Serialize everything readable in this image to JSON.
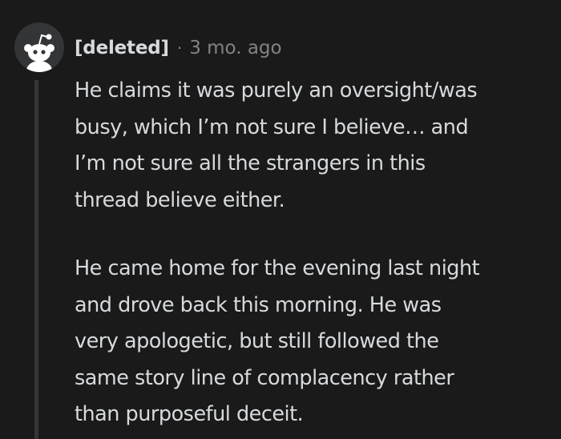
{
  "comment": {
    "author": "[deleted]",
    "separator": "·",
    "timestamp": "3 mo. ago",
    "avatar_icon": "snoo-avatar-icon",
    "paragraphs": [
      "He claims it was purely an oversight/was\nbusy, which I’m not sure I believe… and\nI’m not sure all the strangers in this\nthread believe either.",
      "He came home for the evening last night\nand drove back this morning. He was\nvery apologetic, but still followed the\nsame story line of complacency rather\nthan purposeful deceit."
    ]
  },
  "colors": {
    "background": "#1a1a1b",
    "text": "#d7dadc",
    "meta_text": "#818384",
    "thread_line": "#343536",
    "avatar_bg": "#343536"
  }
}
